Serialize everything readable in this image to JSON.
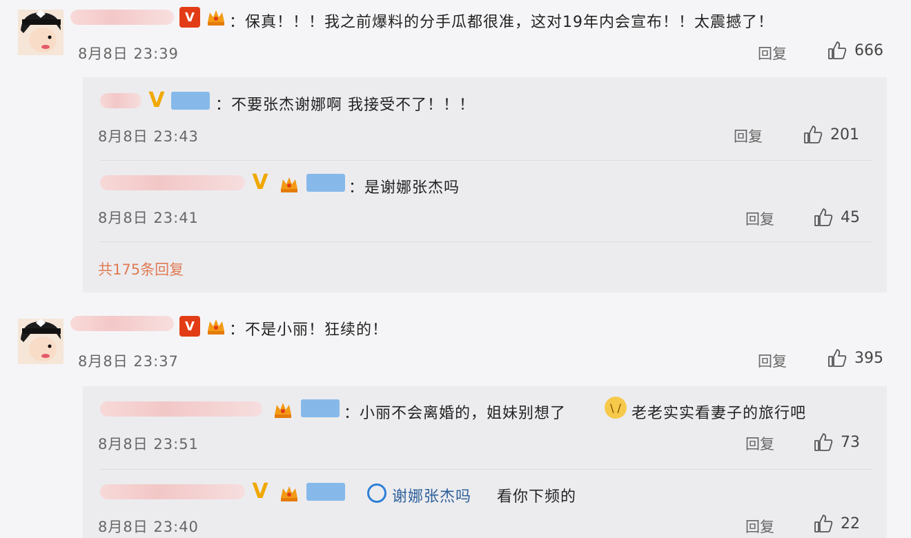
{
  "comments": [
    {
      "text": "：保真！！！我之前爆料的分手瓜都很准，这对19年内会宣布！！太震撼了！",
      "time": "8月8日 23:39",
      "reply_label": "回复",
      "likes": "666",
      "replies": [
        {
          "text": "：不要张杰谢娜啊 我接受不了！！！",
          "time": "8月8日 23:43",
          "reply_label": "回复",
          "likes": "201"
        },
        {
          "text": "：是谢娜张杰吗",
          "time": "8月8日 23:41",
          "reply_label": "回复",
          "likes": "45"
        }
      ],
      "more_replies": "共175条回复"
    },
    {
      "text": "：不是小丽！狂续的！",
      "time": "8月8日 23:37",
      "reply_label": "回复",
      "likes": "395",
      "replies": [
        {
          "text_a": "：小丽不会离婚的，姐妹别想了",
          "text_b": "老老实实看妻子的旅行吧",
          "time": "8月8日 23:51",
          "reply_label": "回复",
          "likes": "73"
        },
        {
          "mention": "谢娜张杰吗",
          "text": "看你下频的",
          "time": "8月8日 23:40",
          "reply_label": "回复",
          "likes": "22"
        }
      ]
    }
  ],
  "icons": {
    "like": "thumbs-up-icon",
    "verified": "verified-v-icon",
    "crown": "crown-icon"
  },
  "colors": {
    "accent_orange": "#e07a52",
    "verified_red": "#e23c16",
    "verified_gold": "#f0a800"
  }
}
